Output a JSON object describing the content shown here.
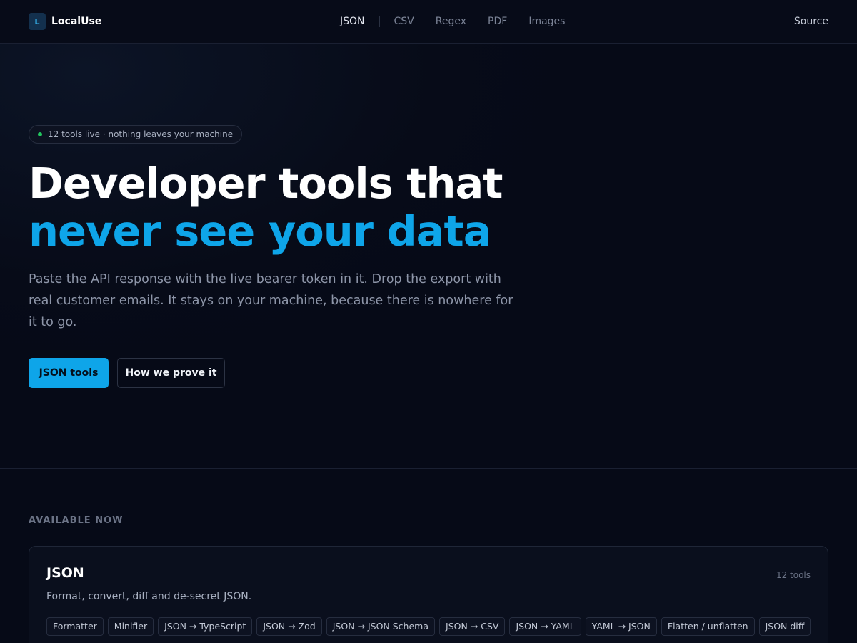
{
  "header": {
    "brand_mark": "L",
    "brand_name": "LocalUse",
    "nav": [
      "JSON",
      "CSV",
      "Regex",
      "PDF",
      "Images"
    ],
    "source": "Source"
  },
  "hero": {
    "status_pill": "12 tools live · nothing leaves your machine",
    "headline_part1": "Developer tools that ",
    "headline_accent": "never see your data",
    "lede": "Paste the API response with the live bearer token in it. Drop the export with real customer emails. It stays on your machine, because there is nowhere for it to go.",
    "primary_cta": "JSON tools",
    "secondary_cta": "How we prove it"
  },
  "available": {
    "label": "AVAILABLE NOW",
    "cards": [
      {
        "title": "JSON",
        "count": "12 tools",
        "description": "Format, convert, diff and de-secret JSON.",
        "tools": [
          "Formatter",
          "Minifier",
          "JSON → TypeScript",
          "JSON → Zod",
          "JSON → JSON Schema",
          "JSON → CSV",
          "JSON → YAML",
          "YAML → JSON",
          "Flatten / unflatten",
          "JSON diff"
        ]
      }
    ]
  },
  "colors": {
    "accent": "#0ea5e9",
    "background": "#060a17",
    "status_dot": "#22c55e"
  }
}
